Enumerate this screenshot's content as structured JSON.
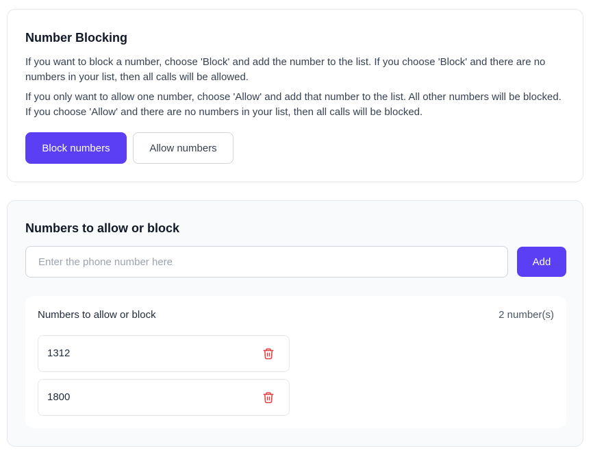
{
  "blocking": {
    "title": "Number Blocking",
    "desc_block": "If you want to block a number, choose 'Block' and add the number to the list. If you choose 'Block' and there are no numbers in your list, then all calls will be allowed.",
    "desc_allow": "If you only want to allow one number, choose 'Allow' and add that number to the list. All other numbers will be blocked. If you choose 'Allow' and there are no numbers in your list, then all calls will be blocked.",
    "block_label": "Block numbers",
    "allow_label": "Allow numbers"
  },
  "numbers": {
    "title": "Numbers to allow or block",
    "input_placeholder": "Enter the phone number here",
    "input_value": "",
    "add_label": "Add",
    "list_label": "Numbers to allow or block",
    "count_label": "2 number(s)",
    "items": [
      {
        "number": "1312",
        "icon": "trash-icon"
      },
      {
        "number": "1800",
        "icon": "trash-icon"
      }
    ]
  },
  "colors": {
    "accent": "#5b3ff5",
    "danger": "#dc3f3f"
  }
}
